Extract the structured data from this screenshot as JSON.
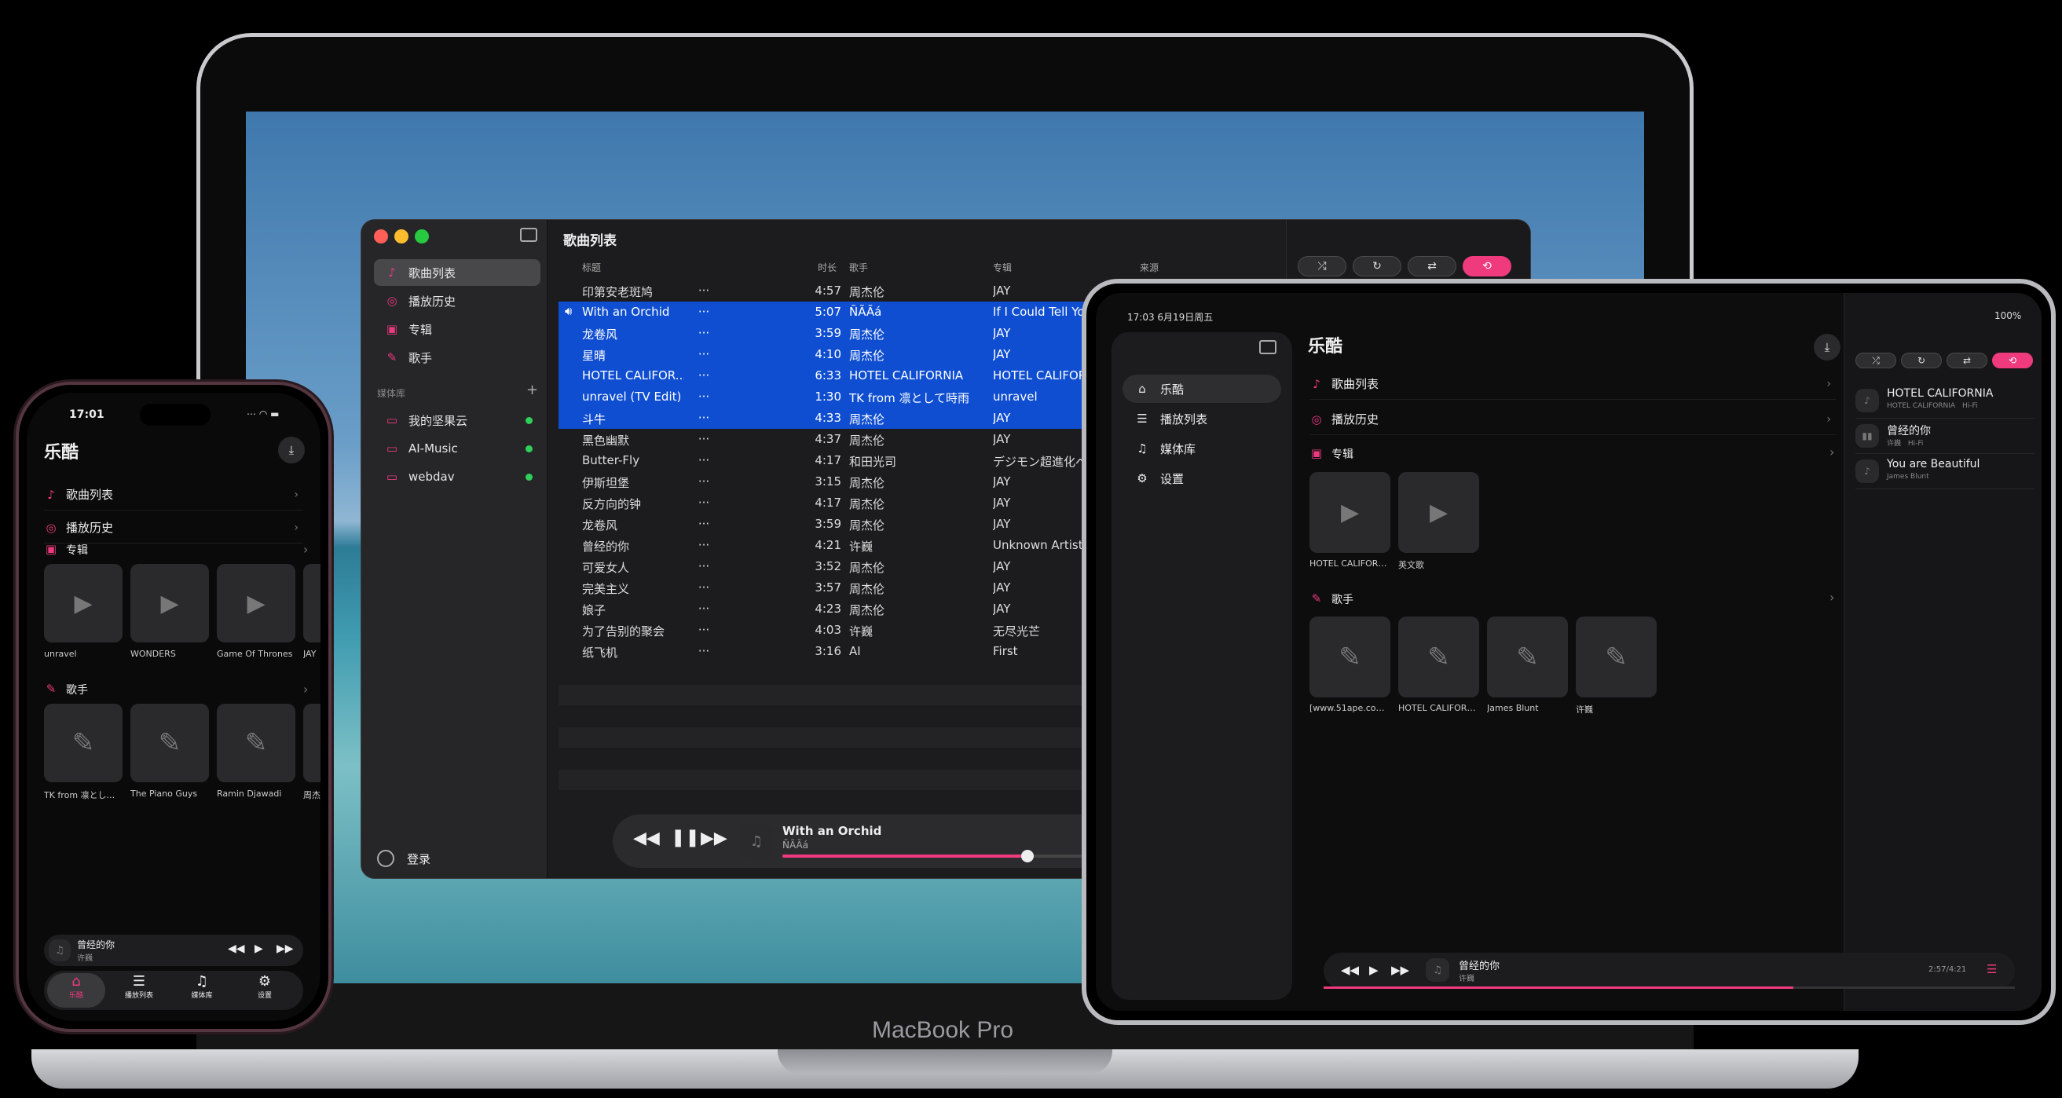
{
  "mac": {
    "page_title": "歌曲列表",
    "sidebar_items": [
      {
        "label": "歌曲列表",
        "icon": "song-list-icon",
        "glyph": "♪"
      },
      {
        "label": "播放历史",
        "icon": "history-icon",
        "glyph": "◎"
      },
      {
        "label": "专辑",
        "icon": "album-icon",
        "glyph": "▣"
      },
      {
        "label": "歌手",
        "icon": "microphone-icon",
        "glyph": "✎"
      }
    ],
    "library_header": "媒体库",
    "add": "+",
    "sources": [
      {
        "label": "我的坚果云"
      },
      {
        "label": "AI-Music"
      },
      {
        "label": "webdav"
      }
    ],
    "login": "登录",
    "columns": {
      "title": "标题",
      "duration": "时长",
      "artist": "歌手",
      "album": "专辑",
      "source": "来源"
    },
    "rows": [
      {
        "title": "印第安老斑鸠",
        "duration": "4:57",
        "artist": "周杰伦",
        "album": "JAY"
      },
      {
        "title": "With an Orchid",
        "duration": "5:07",
        "artist": "ÑÃÃá",
        "album": "If I Could Tell You"
      },
      {
        "title": "龙卷风",
        "duration": "3:59",
        "artist": "周杰伦",
        "album": "JAY"
      },
      {
        "title": "星晴",
        "duration": "4:10",
        "artist": "周杰伦",
        "album": "JAY"
      },
      {
        "title": "HOTEL CALIFOR...",
        "duration": "6:33",
        "artist": "HOTEL CALIFORNIA",
        "album": "HOTEL CALIFORNIA"
      },
      {
        "title": "unravel (TV Edit)",
        "duration": "1:30",
        "artist": "TK from 凛として時雨",
        "album": "unravel"
      },
      {
        "title": "斗牛",
        "duration": "4:33",
        "artist": "周杰伦",
        "album": "JAY"
      },
      {
        "title": "黑色幽默",
        "duration": "4:37",
        "artist": "周杰伦",
        "album": "JAY"
      },
      {
        "title": "Butter-Fly",
        "duration": "4:17",
        "artist": "和田光司",
        "album": "デジモン超進化ベス"
      },
      {
        "title": "伊斯坦堡",
        "duration": "3:15",
        "artist": "周杰伦",
        "album": "JAY"
      },
      {
        "title": "反方向的钟",
        "duration": "4:17",
        "artist": "周杰伦",
        "album": "JAY"
      },
      {
        "title": "龙卷风",
        "duration": "3:59",
        "artist": "周杰伦",
        "album": "JAY"
      },
      {
        "title": "曾经的你",
        "duration": "4:21",
        "artist": "许巍",
        "album": "Unknown Artist"
      },
      {
        "title": "可爱女人",
        "duration": "3:52",
        "artist": "周杰伦",
        "album": "JAY"
      },
      {
        "title": "完美主义",
        "duration": "3:57",
        "artist": "周杰伦",
        "album": "JAY"
      },
      {
        "title": "娘子",
        "duration": "4:23",
        "artist": "周杰伦",
        "album": "JAY"
      },
      {
        "title": "为了告别的聚会",
        "duration": "4:03",
        "artist": "许巍",
        "album": "无尽光芒"
      },
      {
        "title": "纸飞机",
        "duration": "3:16",
        "artist": "AI",
        "album": "First"
      }
    ],
    "more": "···",
    "player": {
      "title": "With an Orchid",
      "artist": "ÑÃÃá",
      "progress": 0.78
    }
  },
  "laptop_brand": "MacBook Pro",
  "iphone": {
    "time": "17:01",
    "title": "乐酷",
    "rows": [
      {
        "label": "歌曲列表"
      },
      {
        "label": "播放历史"
      }
    ],
    "album_header": "专辑",
    "albums": [
      "unravel",
      "WONDERS",
      "Game Of Thrones",
      "JAY"
    ],
    "artist_header": "歌手",
    "artists": [
      "TK from 凛として...",
      "The Piano Guys",
      "Ramin Djawadi",
      "周杰"
    ],
    "player": {
      "title": "曾经的你",
      "artist": "许巍"
    },
    "tabs": [
      {
        "label": "乐酷",
        "icon": "home-icon",
        "glyph": "⌂"
      },
      {
        "label": "播放列表",
        "icon": "list-icon",
        "glyph": "☰"
      },
      {
        "label": "媒体库",
        "icon": "library-icon",
        "glyph": "♫"
      },
      {
        "label": "设置",
        "icon": "gear-icon",
        "glyph": "⚙"
      }
    ]
  },
  "ipad": {
    "status_time": "17:03  6月19日周五",
    "battery": "100%",
    "sidebar_items": [
      {
        "label": "乐酷",
        "icon": "home-icon",
        "glyph": "⌂"
      },
      {
        "label": "播放列表",
        "icon": "list-icon",
        "glyph": "☰"
      },
      {
        "label": "媒体库",
        "icon": "library-icon",
        "glyph": "♫"
      },
      {
        "label": "设置",
        "icon": "gear-icon",
        "glyph": "⚙"
      }
    ],
    "title": "乐酷",
    "rows": [
      {
        "label": "歌曲列表"
      },
      {
        "label": "播放历史"
      }
    ],
    "album_header": "专辑",
    "albums": [
      "HOTEL CALIFORN...",
      "英文歌"
    ],
    "artist_header": "歌手",
    "artists": [
      "[www.51ape.com]...",
      "HOTEL CALIFORN...",
      "James Blunt",
      "许巍"
    ],
    "queue": [
      {
        "title": "HOTEL CALIFORNIA",
        "sub": "HOTEL CALIFORNIA",
        "tag": "Hi-Fi"
      },
      {
        "title": "曾经的你",
        "sub": "许巍",
        "tag": "Hi-Fi"
      },
      {
        "title": "You are Beautiful",
        "sub": "James Blunt",
        "tag": ""
      }
    ],
    "player": {
      "title": "曾经的你",
      "artist": "许巍",
      "time": "2:57/4:21",
      "progress": 0.68
    }
  },
  "colors": {
    "accent": "#ef3a7d",
    "selection": "#0f4ed1"
  }
}
